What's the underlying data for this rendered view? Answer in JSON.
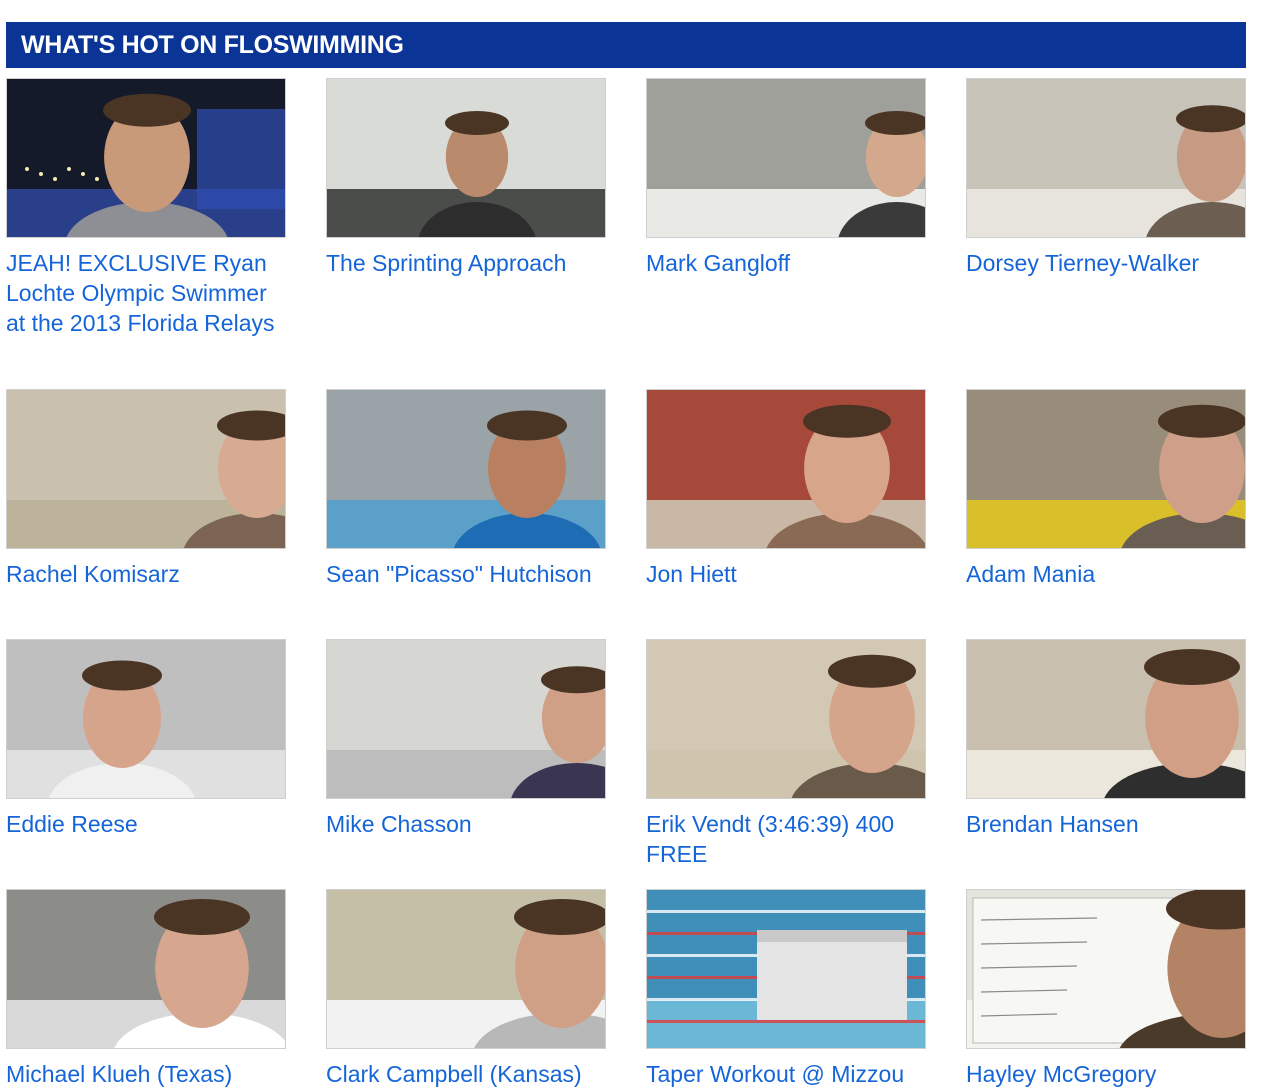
{
  "header": {
    "title": "WHAT'S HOT ON FLOSWIMMING",
    "color": "#0a3596"
  },
  "link_color": "#1565d8",
  "videos": [
    {
      "title": "JEAH! EXCLUSIVE Ryan Lochte Olympic Swimmer at the 2013 Florida Relays",
      "scene": "night"
    },
    {
      "title": "The Sprinting Approach",
      "scene": "indoor-light"
    },
    {
      "title": "Mark Gangloff",
      "scene": "wall"
    },
    {
      "title": "Dorsey Tierney-Walker",
      "scene": "gym"
    },
    {
      "title": "Rachel Komisarz",
      "scene": "plain-wall"
    },
    {
      "title": "Sean \"Picasso\" Hutchison",
      "scene": "pool-hall"
    },
    {
      "title": "Jon Hiett",
      "scene": "stands"
    },
    {
      "title": "Adam Mania",
      "scene": "dive-tower"
    },
    {
      "title": "Eddie Reese",
      "scene": "deck"
    },
    {
      "title": "Mike Chasson",
      "scene": "ceiling"
    },
    {
      "title": "Erik Vendt (3:46:39) 400 FREE",
      "scene": "blank-wall"
    },
    {
      "title": "Brendan Hansen",
      "scene": "gym-banner"
    },
    {
      "title": "Michael Klueh (Texas)",
      "scene": "stands-dark"
    },
    {
      "title": "Clark Campbell (Kansas)",
      "scene": "banners"
    },
    {
      "title": "Taper Workout @ Mizzou",
      "scene": "pool-lanes"
    },
    {
      "title": "Hayley McGregory",
      "scene": "whiteboard"
    }
  ]
}
